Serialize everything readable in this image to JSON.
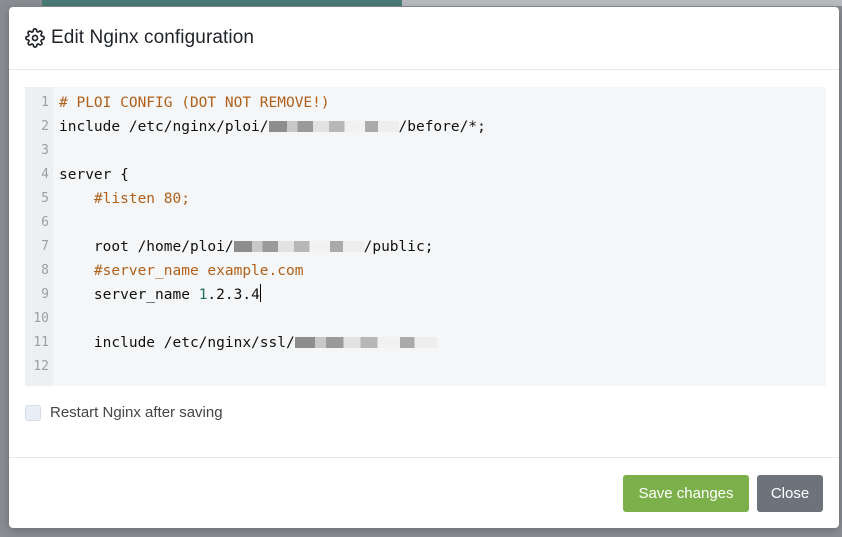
{
  "modal": {
    "title": "Edit Nginx configuration",
    "icon": "gear-icon"
  },
  "editor": {
    "lines": [
      {
        "n": "1",
        "segments": [
          {
            "t": "# PLOI CONFIG (DOT NOT REMOVE!)",
            "c": "comment"
          }
        ]
      },
      {
        "n": "2",
        "segments": [
          {
            "t": "include /etc/nginx/ploi/",
            "c": "text"
          },
          {
            "t": "",
            "c": "redacted"
          },
          {
            "t": "/before/*;",
            "c": "text"
          }
        ]
      },
      {
        "n": "3",
        "segments": []
      },
      {
        "n": "4",
        "segments": [
          {
            "t": "server {",
            "c": "text"
          }
        ]
      },
      {
        "n": "5",
        "segments": [
          {
            "t": "    ",
            "c": "text"
          },
          {
            "t": "#listen 80;",
            "c": "comment"
          }
        ]
      },
      {
        "n": "6",
        "segments": []
      },
      {
        "n": "7",
        "segments": [
          {
            "t": "    root /home/ploi/",
            "c": "text"
          },
          {
            "t": "",
            "c": "redacted"
          },
          {
            "t": "/public;",
            "c": "text"
          }
        ]
      },
      {
        "n": "8",
        "segments": [
          {
            "t": "    ",
            "c": "text"
          },
          {
            "t": "#server_name example.com",
            "c": "comment"
          }
        ]
      },
      {
        "n": "9",
        "segments": [
          {
            "t": "    server_name ",
            "c": "text"
          },
          {
            "t": "1",
            "c": "number"
          },
          {
            "t": ".2.3.4",
            "c": "text"
          },
          {
            "t": "",
            "c": "cursor"
          }
        ]
      },
      {
        "n": "10",
        "segments": []
      },
      {
        "n": "11",
        "segments": [
          {
            "t": "    include /etc/nginx/ssl/",
            "c": "text"
          },
          {
            "t": "",
            "c": "redacted-long"
          }
        ]
      },
      {
        "n": "12",
        "segments": []
      }
    ]
  },
  "options": {
    "restart_label": "Restart Nginx after saving",
    "restart_checked": false
  },
  "footer": {
    "save_label": "Save changes",
    "close_label": "Close"
  },
  "colors": {
    "save": "#7bb04a",
    "close": "#6c737b",
    "comment": "#b0601a"
  }
}
